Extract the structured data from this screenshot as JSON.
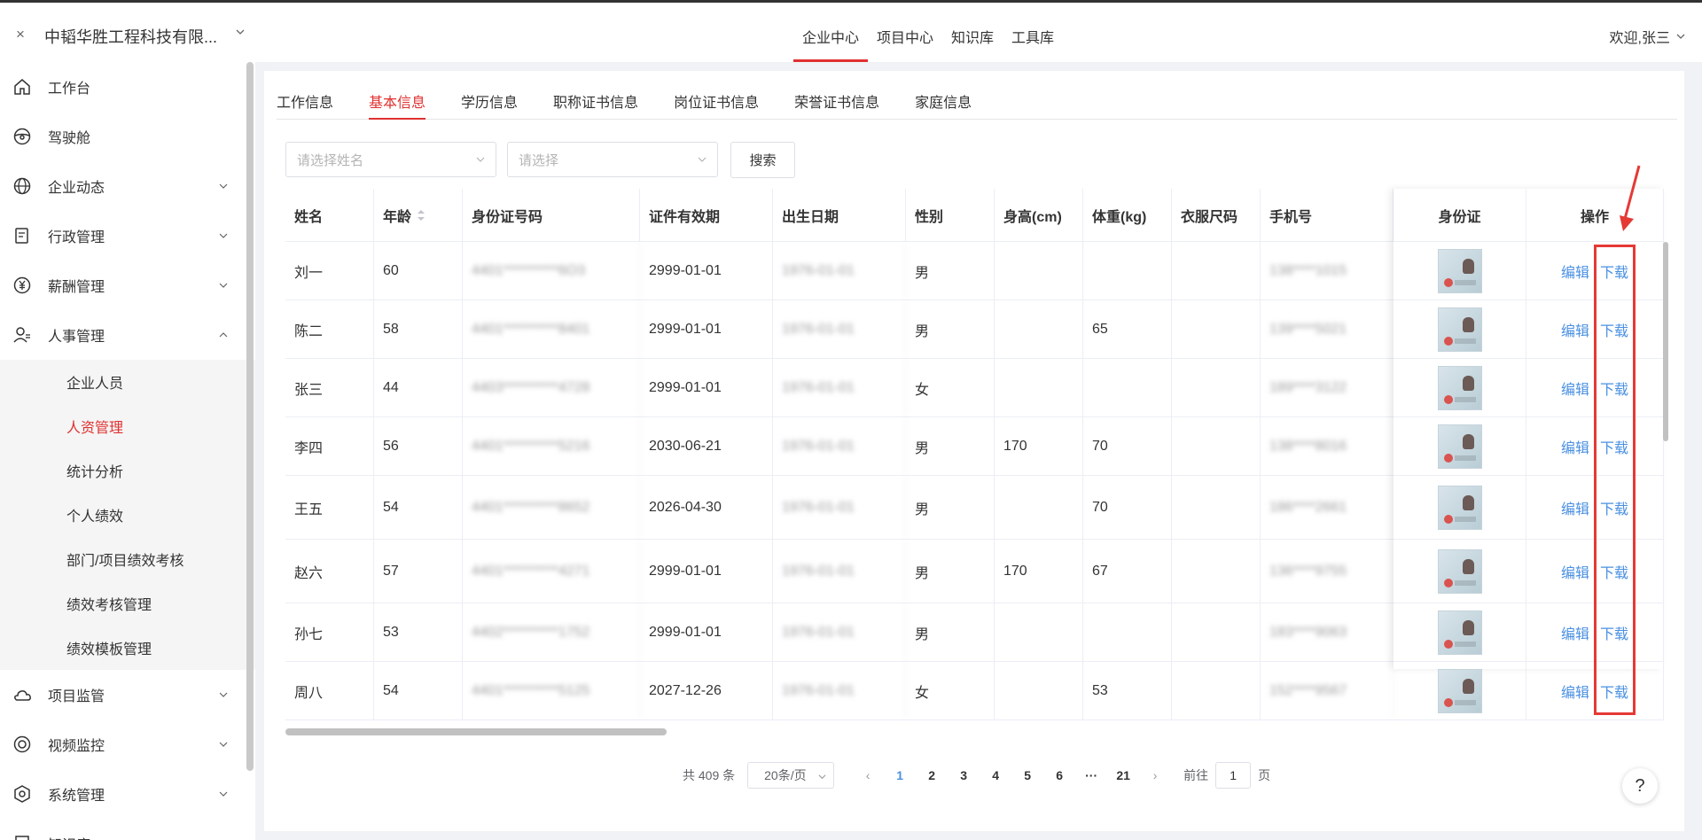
{
  "app": {
    "close_glyph": "×",
    "company": "中韬华胜工程科技有限...",
    "welcome": "欢迎,张三"
  },
  "topnav": [
    {
      "label": "企业中心",
      "active": true
    },
    {
      "label": "项目中心"
    },
    {
      "label": "知识库"
    },
    {
      "label": "工具库"
    }
  ],
  "sidebar": {
    "items": [
      {
        "label": "工作台",
        "icon": "home-icon"
      },
      {
        "label": "驾驶舱",
        "icon": "steering-icon"
      },
      {
        "label": "企业动态",
        "icon": "globe-icon",
        "expandable": true
      },
      {
        "label": "行政管理",
        "icon": "document-icon",
        "expandable": true
      },
      {
        "label": "薪酬管理",
        "icon": "yen-icon",
        "expandable": true
      },
      {
        "label": "人事管理",
        "icon": "person-icon",
        "expandable": true,
        "expanded": true
      }
    ],
    "subitems": [
      {
        "label": "企业人员"
      },
      {
        "label": "人资管理",
        "active": true
      },
      {
        "label": "统计分析"
      },
      {
        "label": "个人绩效"
      },
      {
        "label": "部门/项目绩效考核"
      },
      {
        "label": "绩效考核管理"
      },
      {
        "label": "绩效模板管理"
      }
    ],
    "items_after": [
      {
        "label": "项目监管",
        "icon": "cloud-icon"
      },
      {
        "label": "视频监控",
        "icon": "camera-icon"
      },
      {
        "label": "系统管理",
        "icon": "settings-icon"
      },
      {
        "label": "知识库",
        "icon": "book-icon"
      }
    ]
  },
  "tabs": [
    {
      "label": "工作信息"
    },
    {
      "label": "基本信息",
      "active": true
    },
    {
      "label": "学历信息"
    },
    {
      "label": "职称证书信息"
    },
    {
      "label": "岗位证书信息"
    },
    {
      "label": "荣誉证书信息"
    },
    {
      "label": "家庭信息"
    }
  ],
  "filters": {
    "name_placeholder": "请选择姓名",
    "other_placeholder": "请选择",
    "search_label": "搜索"
  },
  "table": {
    "headers": [
      "姓名",
      "年龄",
      "身份证号码",
      "证件有效期",
      "出生日期",
      "性别",
      "身高(cm)",
      "体重(kg)",
      "衣服尺码",
      "手机号"
    ],
    "fixed_headers": [
      "身份证",
      "操作"
    ],
    "edit_label": "编辑",
    "download_label": "下载",
    "rows": [
      {
        "name": "刘一",
        "age": "60",
        "id": "4401**********6O3",
        "expiry": "2999-01-01",
        "birth": "1976-01-01",
        "gender": "男",
        "height": "",
        "weight": "",
        "size": "",
        "phone": "138****1015"
      },
      {
        "name": "陈二",
        "age": "58",
        "id": "4401**********8401",
        "expiry": "2999-01-01",
        "birth": "1976-01-01",
        "gender": "男",
        "height": "",
        "weight": "65",
        "size": "",
        "phone": "139****5021"
      },
      {
        "name": "张三",
        "age": "44",
        "id": "4403**********4728",
        "expiry": "2999-01-01",
        "birth": "1976-01-01",
        "gender": "女",
        "height": "",
        "weight": "",
        "size": "",
        "phone": "189****3122"
      },
      {
        "name": "李四",
        "age": "56",
        "id": "4401**********5216",
        "expiry": "2030-06-21",
        "birth": "1976-01-01",
        "gender": "男",
        "height": "170",
        "weight": "70",
        "size": "",
        "phone": "138****8016"
      },
      {
        "name": "王五",
        "age": "54",
        "id": "4401**********8652",
        "expiry": "2026-04-30",
        "birth": "1976-01-01",
        "gender": "男",
        "height": "",
        "weight": "70",
        "size": "",
        "phone": "186****2661"
      },
      {
        "name": "赵六",
        "age": "57",
        "id": "4401**********4271",
        "expiry": "2999-01-01",
        "birth": "1976-01-01",
        "gender": "男",
        "height": "170",
        "weight": "67",
        "size": "",
        "phone": "136****9755"
      },
      {
        "name": "孙七",
        "age": "53",
        "id": "4402**********1752",
        "expiry": "2999-01-01",
        "birth": "1976-01-01",
        "gender": "男",
        "height": "",
        "weight": "",
        "size": "",
        "phone": "183****9063"
      },
      {
        "name": "周八",
        "age": "54",
        "id": "4401**********5125",
        "expiry": "2027-12-26",
        "birth": "1976-01-01",
        "gender": "女",
        "height": "",
        "weight": "53",
        "size": "",
        "phone": "152****9567"
      }
    ]
  },
  "pagination": {
    "total": "共 409 条",
    "page_size": "20条/页",
    "prev": "‹",
    "next": "›",
    "pages": [
      "1",
      "2",
      "3",
      "4",
      "5",
      "6",
      "···",
      "21"
    ],
    "current": "1",
    "goto_label": "前往",
    "goto_value": "1",
    "page_suffix": "页"
  },
  "help_label": "?",
  "colors": {
    "accent": "#e03131",
    "link": "#4a90e2",
    "annotation": "#e53935"
  }
}
